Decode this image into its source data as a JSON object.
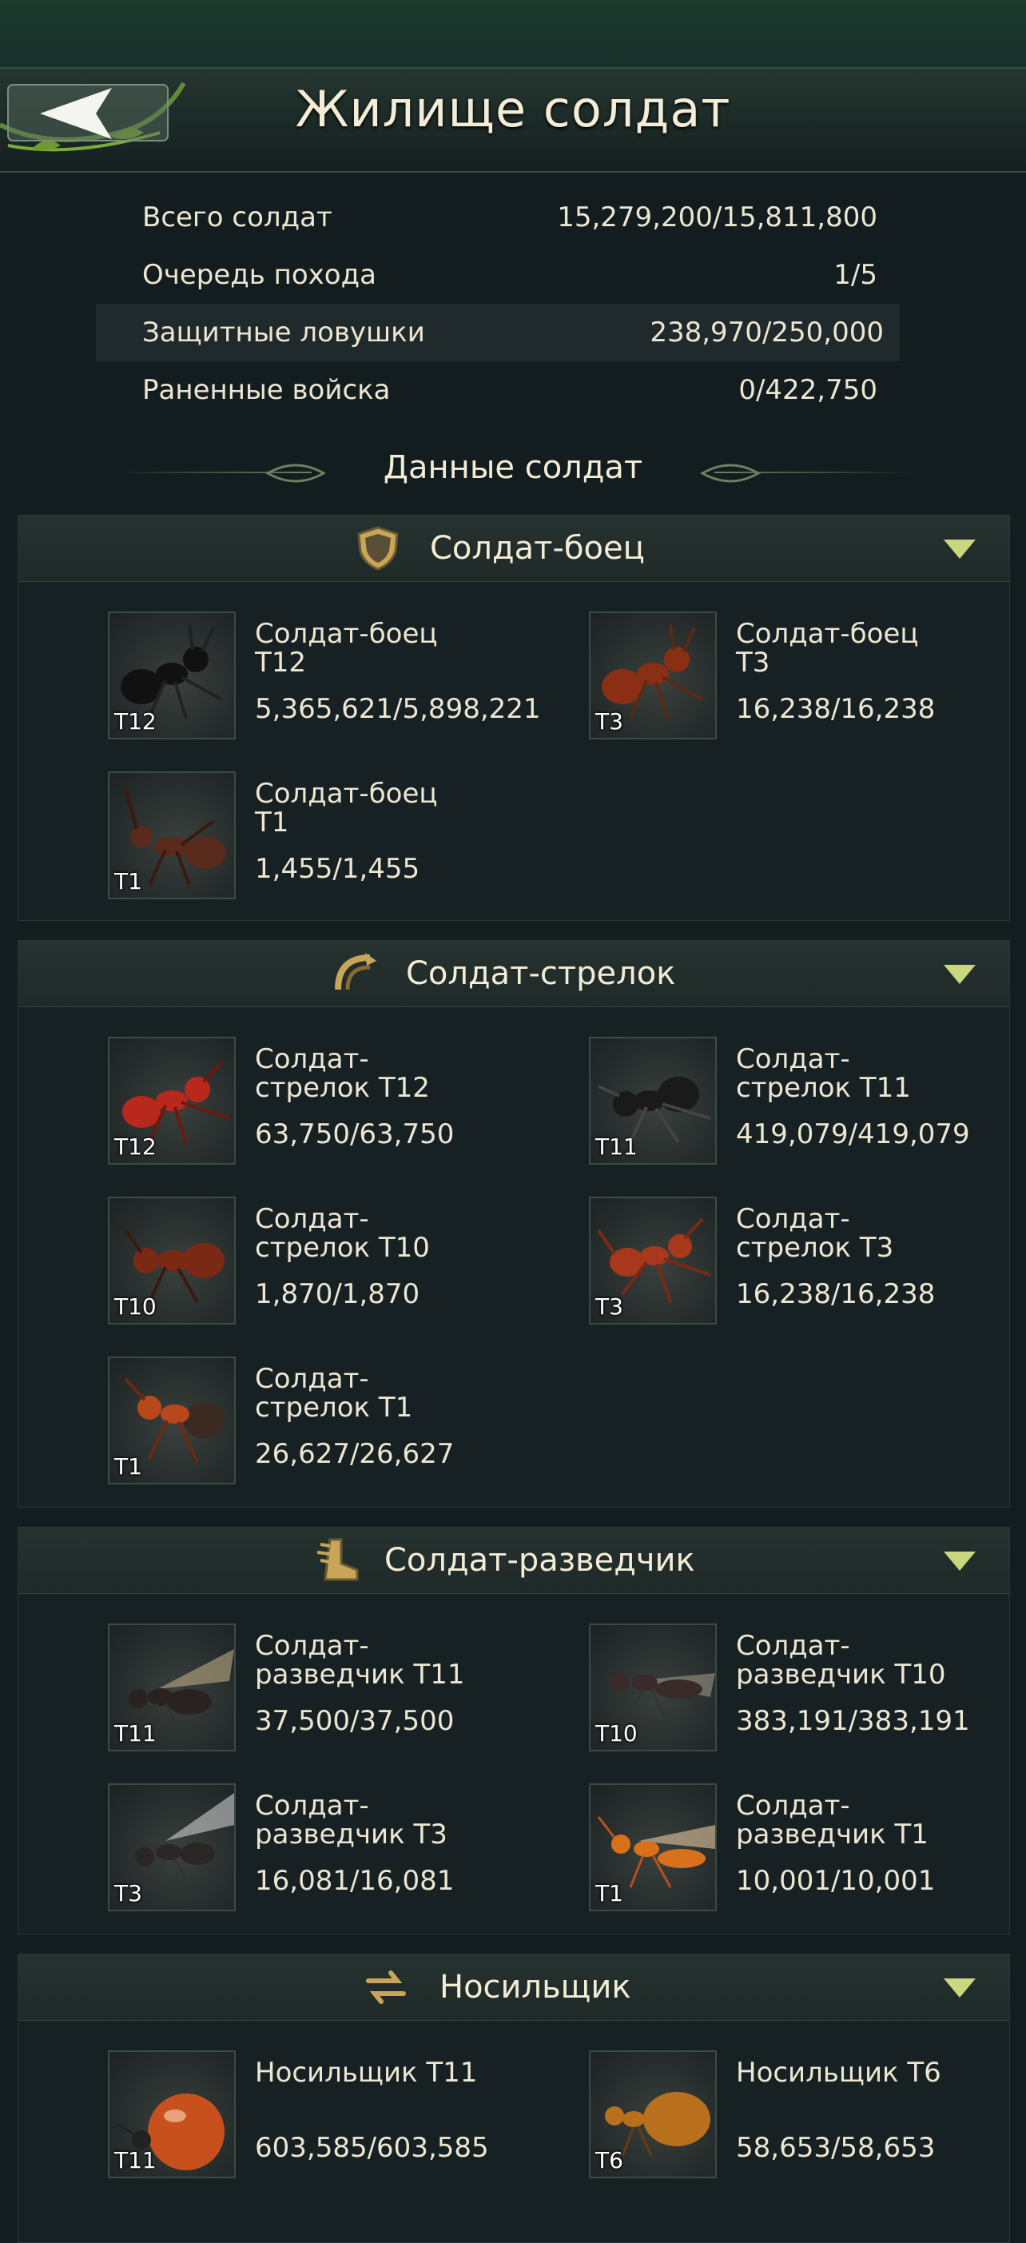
{
  "header": {
    "title": "Жилище солдат"
  },
  "stats": [
    {
      "label": "Всего солдат",
      "value": "15,279,200/15,811,800"
    },
    {
      "label": "Очередь похода",
      "value": "1/5"
    },
    {
      "label": "Защитные ловушки",
      "value": "238,970/250,000"
    },
    {
      "label": "Раненные войска",
      "value": "0/422,750"
    }
  ],
  "data_title": "Данные солдат",
  "sections": [
    {
      "title": "Солдат-боец",
      "icon": "shield-icon",
      "units": [
        {
          "name": "Солдат-боец T12",
          "count": "5,365,621/5,898,221",
          "tier": "T12",
          "color": "#111111"
        },
        {
          "name": "Солдат-боец T3",
          "count": "16,238/16,238",
          "tier": "T3",
          "color": "#8a2e14"
        },
        {
          "name": "Солдат-боец T1",
          "count": "1,455/1,455",
          "tier": "T1",
          "color": "#5a2a1c"
        }
      ]
    },
    {
      "title": "Солдат-стрелок",
      "icon": "bow-icon",
      "units": [
        {
          "name": "Солдат-стрелок T12",
          "count": "63,750/63,750",
          "tier": "T12",
          "color": "#b8281c"
        },
        {
          "name": "Солдат-стрелок T11",
          "count": "419,079/419,079",
          "tier": "T11",
          "color": "#1a1a1a"
        },
        {
          "name": "Солдат-стрелок T10",
          "count": "1,870/1,870",
          "tier": "T10",
          "color": "#7a2a14"
        },
        {
          "name": "Солдат-стрелок T3",
          "count": "16,238/16,238",
          "tier": "T3",
          "color": "#a8381c"
        },
        {
          "name": "Солдат-стрелок T1",
          "count": "26,627/26,627",
          "tier": "T1",
          "color": "#b8481c"
        }
      ]
    },
    {
      "title": "Солдат-разведчик",
      "icon": "boot-icon",
      "units": [
        {
          "name": "Солдат-разведчик T11",
          "count": "37,500/37,500",
          "tier": "T11",
          "color": "#2a2220"
        },
        {
          "name": "Солдат-разведчик T10",
          "count": "383,191/383,191",
          "tier": "T10",
          "color": "#3a2a2a"
        },
        {
          "name": "Солдат-разведчик T3",
          "count": "16,081/16,081",
          "tier": "T3",
          "color": "#2a2626"
        },
        {
          "name": "Солдат-разведчик T1",
          "count": "10,001/10,001",
          "tier": "T1",
          "color": "#d8701c"
        }
      ]
    },
    {
      "title": "Носильщик",
      "icon": "transfer-arrows-icon",
      "units": [
        {
          "name": "Носильщик T11",
          "count": "603,585/603,585",
          "tier": "T11",
          "color": "#c8501c"
        },
        {
          "name": "Носильщик T6",
          "count": "58,653/58,653",
          "tier": "T6",
          "color": "#b8701c"
        }
      ]
    }
  ],
  "colors": {
    "accent": "#c9d77f",
    "text": "#ece6d2",
    "panel": "#172124"
  }
}
